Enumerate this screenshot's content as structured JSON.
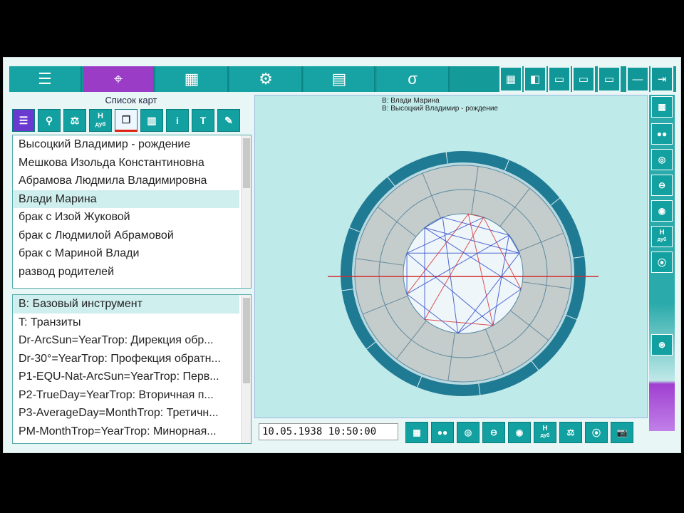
{
  "chart_list": {
    "title": "Список карт",
    "items": [
      "Высоцкий Владимир - рождение",
      "Мешкова Изольда Константиновна",
      "Абрамова Людмила Владимировна",
      "Влади Марина",
      "брак с Изой Жуковой",
      "брак с Людмилой Абрамовой",
      "брак с Мариной Влади",
      "развод родителей"
    ],
    "selected_index": 3
  },
  "methods_list": {
    "items": [
      "B: Базовый инструмент",
      "T: Транзиты",
      "Dr-ArcSun=YearTrop: Дирекция обр...",
      "Dr-30°=YearTrop: Профекция обратн...",
      "P1-EQU-Nat-ArcSun=YearTrop: Перв...",
      "P2-TrueDay=YearTrop: Вторичная п...",
      "P3-AverageDay=MonthTrop: Третичн...",
      "PM-MonthTrop=YearTrop: Минорная..."
    ],
    "selected_index": 0
  },
  "chart": {
    "legend_line1": "B: Влади Марина",
    "legend_line2": "B: Высоцкий Владимир - рождение"
  },
  "datetime": "10.05.1938 10:50:00",
  "toolbar_icons": [
    "menu-icon",
    "crosshair-icon",
    "grid-icon",
    "gear-icon",
    "calculator-icon",
    "sigma-icon"
  ],
  "left_toolbar": {
    "h_label_top": "H",
    "h_label_bottom": "дуб",
    "t_label": "T",
    "i_label": "i"
  },
  "colors": {
    "teal": "#17a3a3",
    "active_tab": "#9b3cc7",
    "ring_outer": "#1f7a94",
    "ring_inner": "#c4cccc",
    "aspect_blue": "#2a46c8",
    "aspect_red": "#d42a2a"
  }
}
